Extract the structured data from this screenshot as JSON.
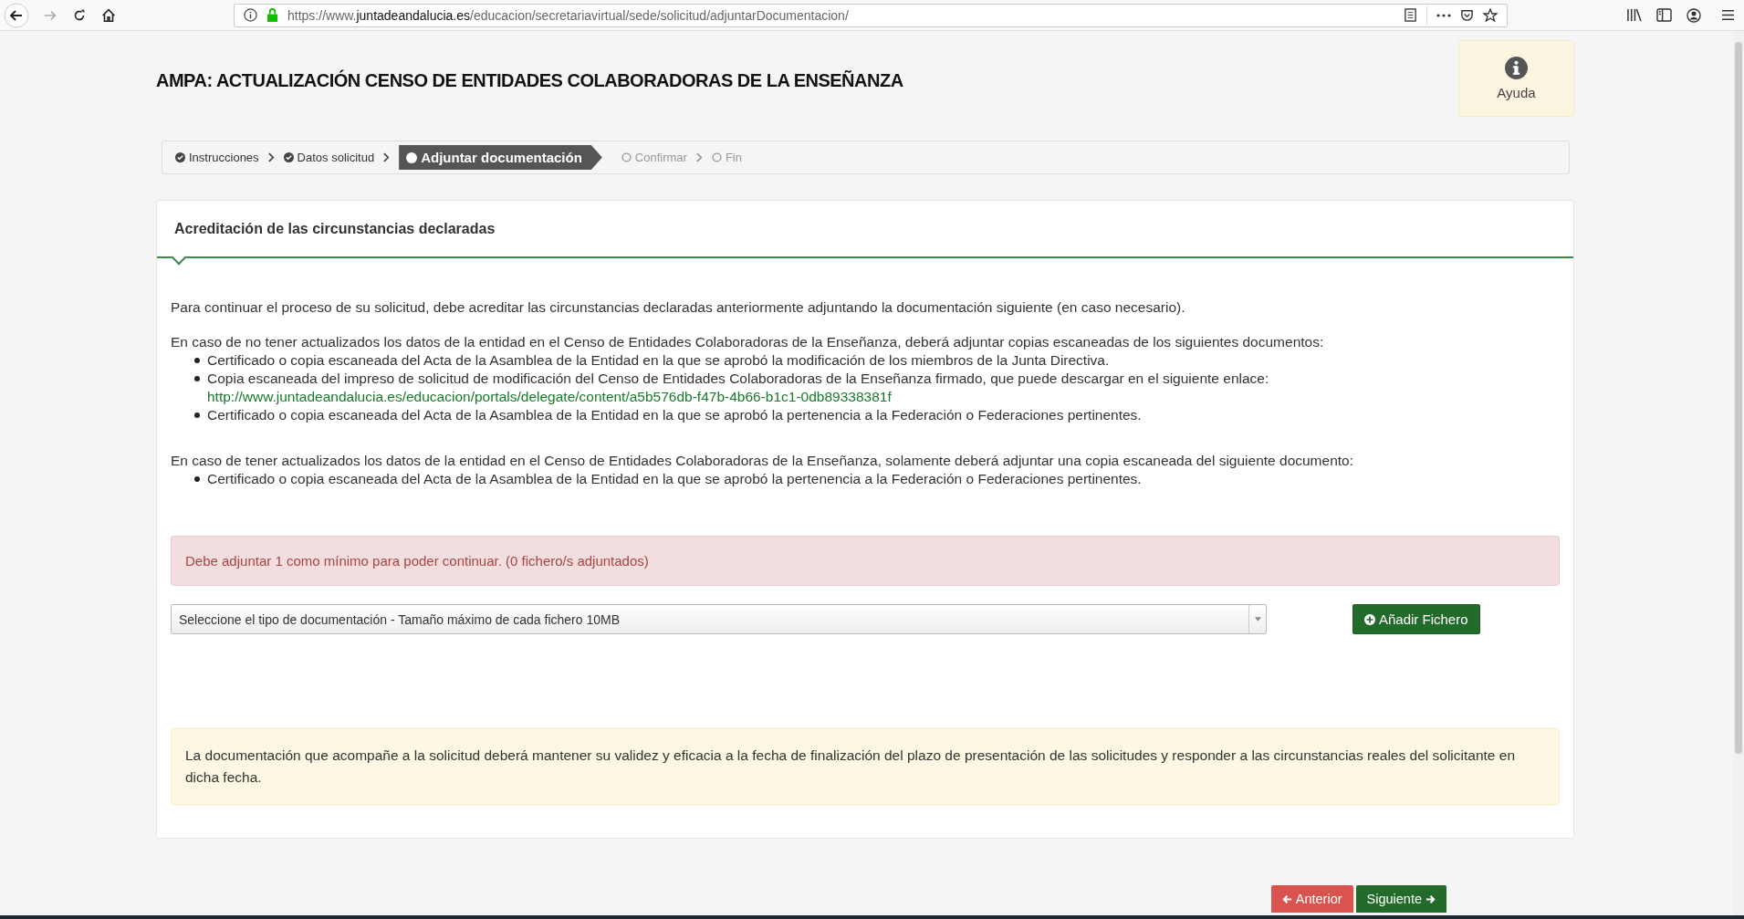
{
  "browser": {
    "url": {
      "scheme": "https://www.",
      "host": "juntadeandalucia.es",
      "path": "/educacion/secretariavirtual/sede/solicitud/adjuntarDocumentacion/"
    }
  },
  "page": {
    "title": "AMPA: ACTUALIZACIÓN CENSO DE ENTIDADES COLABORADORAS DE LA ENSEÑANZA",
    "help": "Ayuda"
  },
  "steps": [
    {
      "label": "Instrucciones",
      "kind": "done"
    },
    {
      "label": "Datos solicitud",
      "kind": "done"
    },
    {
      "label": "Adjuntar documentación",
      "kind": "current"
    },
    {
      "label": "Confirmar",
      "kind": "pending"
    },
    {
      "label": "Fin",
      "kind": "pending"
    }
  ],
  "panel": {
    "title": "Acreditación de las circunstancias declaradas",
    "intro": "Para continuar el proceso de su solicitud, debe acreditar las circunstancias declaradas anteriormente adjuntando la documentación siguiente (en caso necesario).",
    "sections": [
      {
        "text": "En caso de no tener actualizados los datos de la entidad en el Censo de Entidades Colaboradoras de la Enseñanza, deberá adjuntar copias escaneadas de los siguientes documentos:",
        "items": [
          {
            "text": "Certificado o copia escaneada del Acta de la Asamblea de la Entidad en la que se aprobó la modificación de los miembros de la Junta Directiva."
          },
          {
            "text": "Copia escaneada del impreso de solicitud de modificación del Censo de Entidades Colaboradoras de la Enseñanza firmado, que puede descargar en el siguiente enlace:",
            "link": "http://www.juntadeandalucia.es/educacion/portals/delegate/content/a5b576db-f47b-4b66-b1c1-0db89338381f"
          },
          {
            "text": "Certificado o copia escaneada del Acta de la Asamblea de la Entidad en la que se aprobó la pertenencia a la Federación o Federaciones pertinentes."
          }
        ]
      },
      {
        "text": "En caso de tener actualizados los datos de la entidad en el Censo de Entidades Colaboradoras de la Enseñanza, solamente deberá adjuntar una copia escaneada del siguiente documento:",
        "items": [
          {
            "text": "Certificado o copia escaneada del Acta de la Asamblea de la Entidad en la que se aprobó la pertenencia a la Federación o Federaciones pertinentes."
          }
        ]
      }
    ],
    "alert": "Debe adjuntar 1 como mínimo para poder continuar. (0 fichero/s adjuntados)",
    "select": {
      "value": "Seleccione el tipo de documentación - Tamaño máximo de cada fichero 10MB"
    },
    "add_button": "Añadir Fichero",
    "notice": "La documentación que acompañe a la solicitud deberá mantener su validez y eficacia a la fecha de finalización del plazo de presentación de las solicitudes y responder a las circunstancias reales del solicitante en dicha fecha."
  },
  "nav_buttons": [
    {
      "label": "Anterior",
      "kind": "back"
    },
    {
      "label": "Siguiente",
      "kind": "next"
    }
  ]
}
